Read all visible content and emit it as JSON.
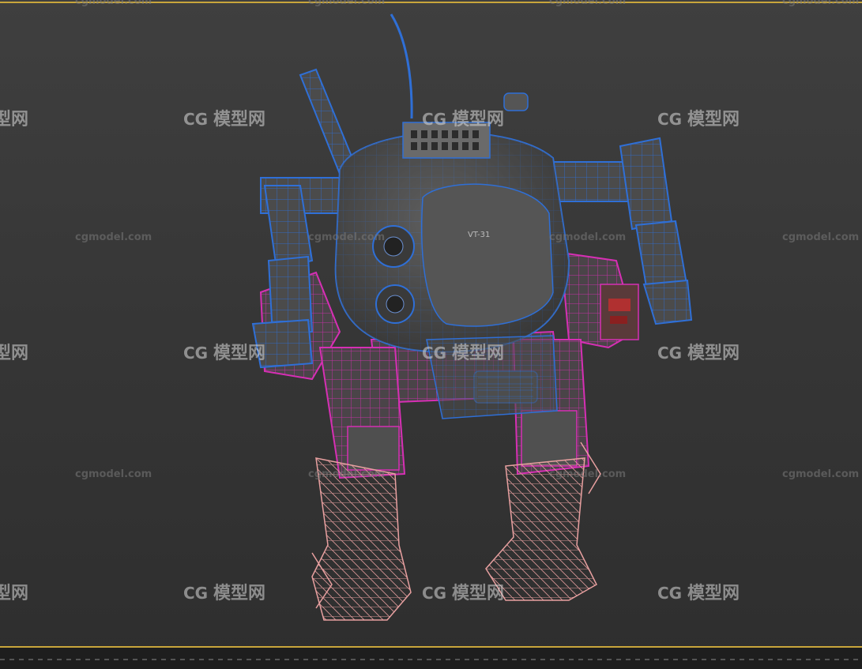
{
  "watermark": {
    "site": "cgmodel.com",
    "brand_cn": "模型网",
    "logo_glyph": "CG"
  },
  "colors": {
    "frame": "#c8a53b",
    "wire_blue": "#2f6fd6",
    "wire_magenta": "#d62fb4",
    "wire_pink": "#e8a0a0",
    "body_gray": "#4a4a4a"
  },
  "scene": {
    "viewport": "3d-perspective",
    "object": "mech-robot-wireframe-on-shaded",
    "chest_label": "VT-31"
  }
}
